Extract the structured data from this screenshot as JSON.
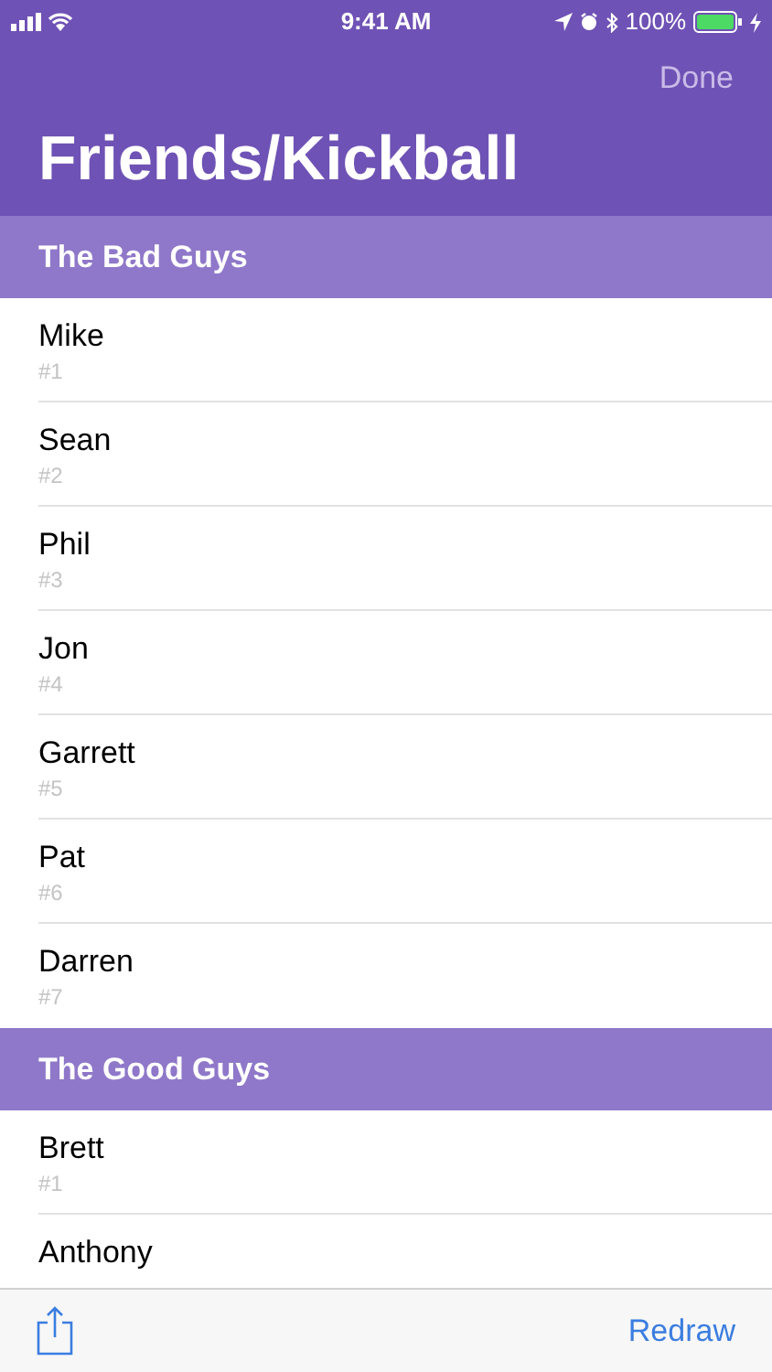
{
  "status_bar": {
    "time": "9:41 AM",
    "battery": "100%"
  },
  "nav": {
    "action": "Done",
    "title": "Friends/Kickball"
  },
  "sections": [
    {
      "title": "The Bad Guys",
      "rows": [
        {
          "name": "Mike",
          "number": "#1"
        },
        {
          "name": "Sean",
          "number": "#2"
        },
        {
          "name": "Phil",
          "number": "#3"
        },
        {
          "name": "Jon",
          "number": "#4"
        },
        {
          "name": "Garrett",
          "number": "#5"
        },
        {
          "name": "Pat",
          "number": "#6"
        },
        {
          "name": "Darren",
          "number": "#7"
        }
      ]
    },
    {
      "title": "The Good Guys",
      "rows": [
        {
          "name": "Brett",
          "number": "#1"
        },
        {
          "name": "Anthony"
        }
      ]
    }
  ],
  "toolbar": {
    "action": "Redraw"
  }
}
